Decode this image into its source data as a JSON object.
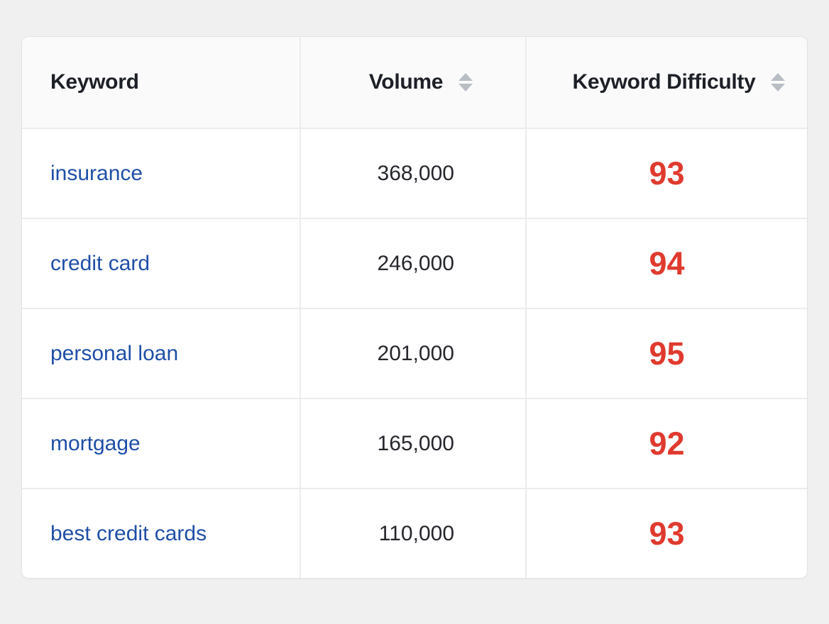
{
  "colors": {
    "link": "#1f4fa6",
    "difficulty_high": "#e03a2f",
    "header_bg": "#fafafa",
    "page_bg": "#f0f0f0"
  },
  "table": {
    "headers": {
      "keyword": "Keyword",
      "volume": "Volume",
      "difficulty": "Keyword Difficulty"
    },
    "sort_icon": "sort-updown-icon",
    "rows": [
      {
        "keyword": "insurance",
        "volume": "368,000",
        "difficulty": "93"
      },
      {
        "keyword": "credit card",
        "volume": "246,000",
        "difficulty": "94"
      },
      {
        "keyword": "personal loan",
        "volume": "201,000",
        "difficulty": "95"
      },
      {
        "keyword": "mortgage",
        "volume": "165,000",
        "difficulty": "92"
      },
      {
        "keyword": "best credit cards",
        "volume": "110,000",
        "difficulty": "93"
      }
    ]
  }
}
